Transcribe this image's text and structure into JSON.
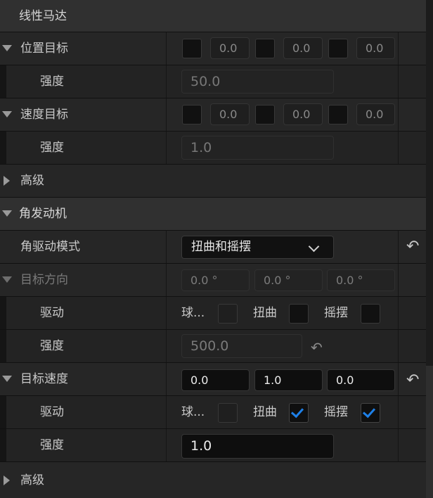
{
  "linear_motor": {
    "title": "线性马达",
    "position_target": {
      "label": "位置目标",
      "x": "0.0",
      "y": "0.0",
      "z": "0.0"
    },
    "strength_1": {
      "label": "强度",
      "value": "50.0"
    },
    "velocity_target": {
      "label": "速度目标",
      "x": "0.0",
      "y": "0.0",
      "z": "0.0"
    },
    "strength_2": {
      "label": "强度",
      "value": "1.0"
    },
    "advanced": {
      "label": "高级"
    }
  },
  "angular_motor": {
    "title": "角发动机",
    "drive_mode": {
      "label": "角驱动模式",
      "value": "扭曲和摇摆",
      "reset_icon": "reset-arrow-icon"
    },
    "target_orientation": {
      "label": "目标方向",
      "x": "0.0 °",
      "y": "0.0 °",
      "z": "0.0 °"
    },
    "orientation_drive": {
      "label": "驱动",
      "slerp": "球...",
      "twist": "扭曲",
      "swing": "摇摆",
      "slerp_on": false,
      "twist_on": false,
      "swing_on": false
    },
    "orientation_strength": {
      "label": "强度",
      "value": "500.0"
    },
    "target_velocity": {
      "label": "目标速度",
      "x": "0.0",
      "y": "1.0",
      "z": "0.0"
    },
    "velocity_drive": {
      "label": "驱动",
      "slerp": "球...",
      "twist": "扭曲",
      "swing": "摇摆",
      "slerp_on": false,
      "twist_on": true,
      "swing_on": true
    },
    "velocity_strength": {
      "label": "强度",
      "value": "1.0"
    },
    "advanced": {
      "label": "高级"
    }
  },
  "colors": {
    "checkbox_check": "#1e80e8",
    "category_bg": "#303030"
  }
}
